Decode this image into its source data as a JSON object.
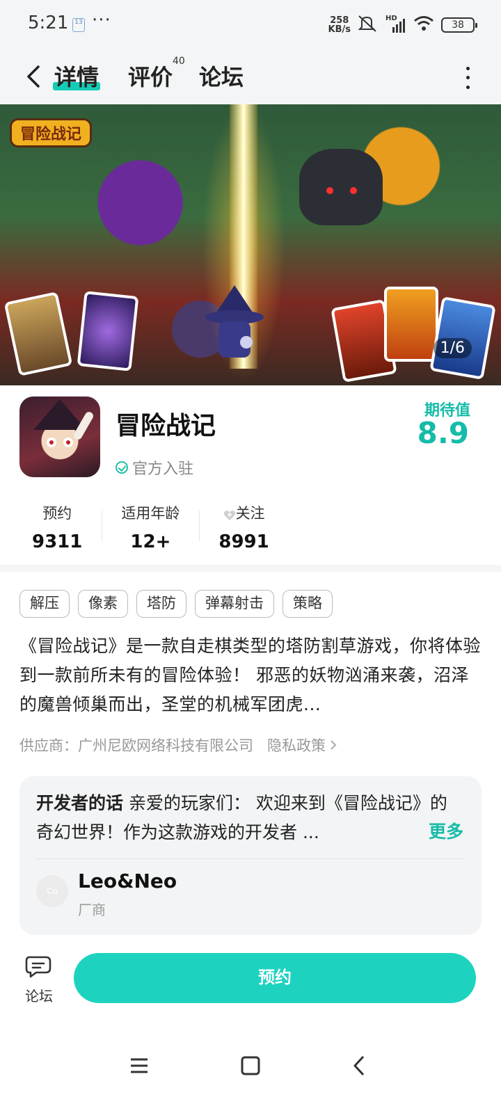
{
  "status_bar": {
    "time": "5:21",
    "notif_badge": "13",
    "more": "···",
    "net_speed_value": "258",
    "net_speed_unit": "KB/s",
    "signal_label": "HD",
    "battery": "38"
  },
  "nav": {
    "tabs": [
      {
        "label": "详情",
        "active": true
      },
      {
        "label": "评价",
        "badge": "40"
      },
      {
        "label": "论坛"
      }
    ]
  },
  "banner": {
    "logo_text": "冒险战记",
    "counter": "1/6"
  },
  "app": {
    "name": "冒险战记",
    "official_label": "官方入驻",
    "expect_label": "期待值",
    "expect_score": "8.9"
  },
  "stats": [
    {
      "label": "预约",
      "value": "9311"
    },
    {
      "label": "适用年龄",
      "value": "12+"
    },
    {
      "label": "关注",
      "value": "8991"
    }
  ],
  "tags": [
    "解压",
    "像素",
    "塔防",
    "弹幕射击",
    "策略"
  ],
  "description": "《冒险战记》是一款自走棋类型的塔防割草游戏，你将体验到一款前所未有的冒险体验！ 邪恶的妖物汹涌来袭，沼泽的魔兽倾巢而出，圣堂的机械军团虎...",
  "supplier": {
    "text": "供应商：广州尼欧网络科技有限公司",
    "privacy": "隐私政策"
  },
  "developer": {
    "heading": "开发者的话",
    "text": "亲爱的玩家们： 欢迎来到《冒险战记》的奇幻世界！作为这款游戏的开发者 ...",
    "more": "更多",
    "avatar_text": "Co",
    "name": "Leo&Neo",
    "role": "厂商"
  },
  "bottom_bar": {
    "forum_label": "论坛",
    "reserve_label": "预约"
  },
  "colors": {
    "accent": "#1dd3bf",
    "accent_text": "#15bca8",
    "background_gray": "#f4f5f6"
  }
}
